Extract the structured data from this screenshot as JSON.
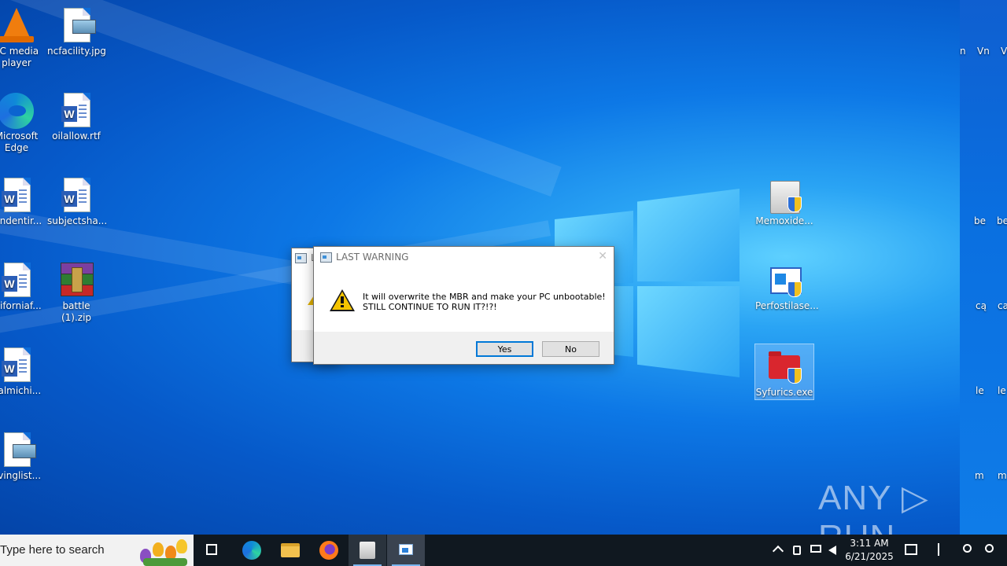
{
  "desktop": {
    "icons_left": [
      {
        "label": "LC media\nplayer",
        "kind": "vlc"
      },
      {
        "label": "Microsoft\nEdge",
        "kind": "edge"
      },
      {
        "label": "hindentir...",
        "kind": "word"
      },
      {
        "label": "aliforniaf...",
        "kind": "word"
      },
      {
        "label": "galmichi...",
        "kind": "word"
      },
      {
        "label": "ovinglist...",
        "kind": "image"
      }
    ],
    "icons_col2": [
      {
        "label": "ncfacility.jpg",
        "kind": "image"
      },
      {
        "label": "oilallow.rtf",
        "kind": "word"
      },
      {
        "label": "subjectsha...",
        "kind": "word"
      },
      {
        "label": "battle (1).zip",
        "kind": "rar"
      }
    ],
    "icons_right": [
      {
        "label": "Memoxide...",
        "kind": "drive"
      },
      {
        "label": "Perfostilase...",
        "kind": "installer"
      },
      {
        "label": "Syfurics.exe",
        "kind": "folder-shield",
        "selected": true
      }
    ],
    "right_strip_labels": [
      "n",
      "Vn",
      "V",
      "be",
      "be",
      "cą",
      "ca",
      "le",
      "le",
      "m",
      "m"
    ]
  },
  "back_dialog": {
    "title": "L"
  },
  "dialog": {
    "title": "LAST WARNING",
    "close_symbol": "✕",
    "message": "It will overwrite the MBR and make your PC unbootable!\nSTILL CONTINUE TO RUN IT?!?!",
    "yes_label": "Yes",
    "no_label": "No"
  },
  "taskbar": {
    "search_placeholder": "Type here to search",
    "clock_time": "3:11 AM",
    "clock_date": "6/21/2025",
    "tray_icons": [
      "chevron-up-icon",
      "usb-icon",
      "network-icon",
      "volume-icon"
    ]
  },
  "watermark": "ANY ▷ RUN"
}
